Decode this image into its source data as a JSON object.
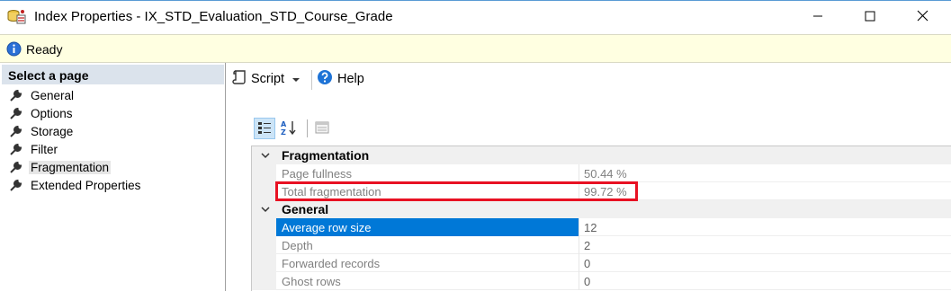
{
  "window": {
    "title": "Index Properties - IX_STD_Evaluation_STD_Course_Grade",
    "controls": {
      "minimize": "minimize",
      "maximize": "maximize",
      "close": "close"
    }
  },
  "status": {
    "text": "Ready",
    "icon": "info-icon"
  },
  "sidebar": {
    "header": "Select a page",
    "items": [
      {
        "label": "General",
        "icon": "wrench-icon",
        "selected": false
      },
      {
        "label": "Options",
        "icon": "wrench-icon",
        "selected": false
      },
      {
        "label": "Storage",
        "icon": "wrench-icon",
        "selected": false
      },
      {
        "label": "Filter",
        "icon": "wrench-icon",
        "selected": false
      },
      {
        "label": "Fragmentation",
        "icon": "wrench-icon",
        "selected": true
      },
      {
        "label": "Extended Properties",
        "icon": "wrench-icon",
        "selected": false
      }
    ]
  },
  "toolbar": {
    "script_label": "Script",
    "help_label": "Help"
  },
  "property_grid": {
    "categories": [
      {
        "label": "Fragmentation",
        "rows": [
          {
            "name": "Page fullness",
            "value": "50.44 %"
          },
          {
            "name": "Total fragmentation",
            "value": "99.72 %"
          }
        ]
      },
      {
        "label": "General",
        "rows": [
          {
            "name": "Average row size",
            "value": "12",
            "selected": true
          },
          {
            "name": "Depth",
            "value": "2"
          },
          {
            "name": "Forwarded records",
            "value": "0"
          },
          {
            "name": "Ghost rows",
            "value": "0"
          }
        ]
      }
    ]
  },
  "colors": {
    "accent": "#0078d7",
    "status_bg": "#ffffe1",
    "annotation_red": "#e81123",
    "sidebar_header_bg": "#dbe3ec"
  }
}
